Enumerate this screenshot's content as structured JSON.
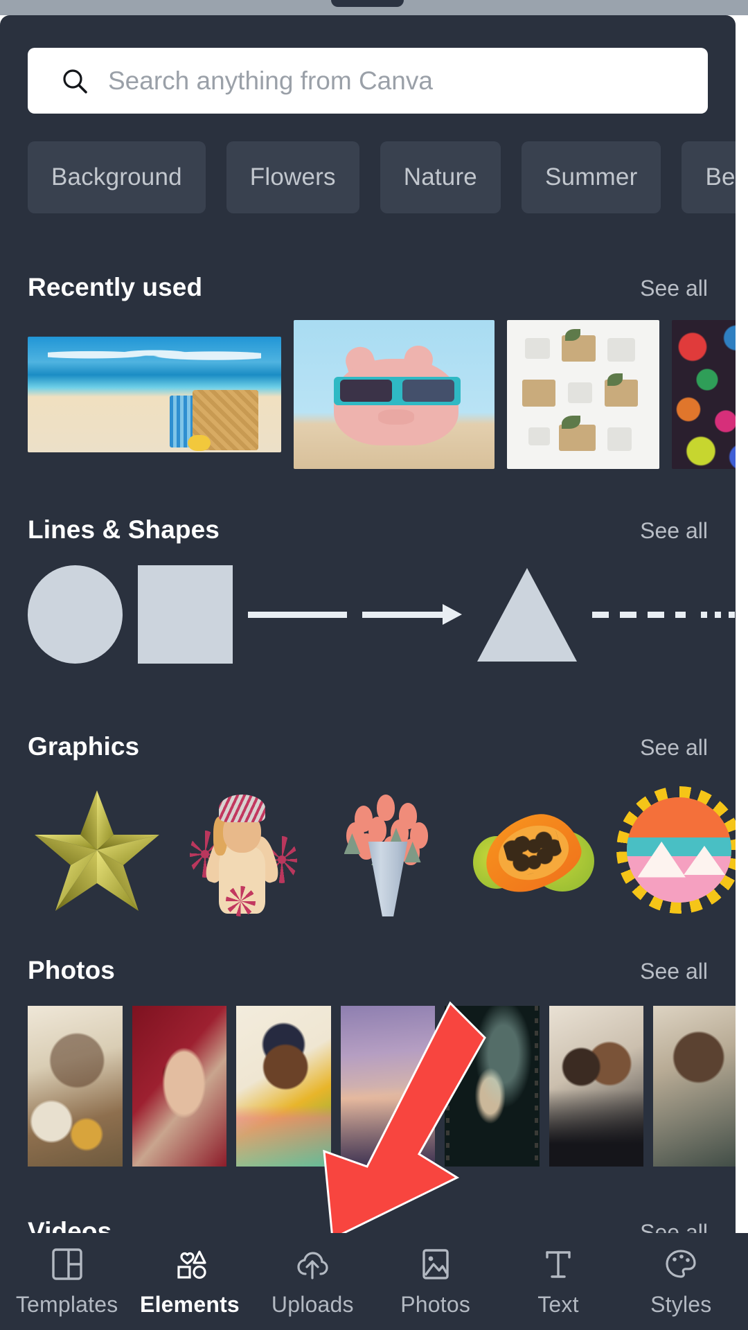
{
  "window": {
    "drag_handle": "sheet-drag-handle"
  },
  "search": {
    "placeholder": "Search anything from Canva",
    "value": "",
    "icon": "search-icon"
  },
  "chips": [
    {
      "label": "Background"
    },
    {
      "label": "Flowers"
    },
    {
      "label": "Nature"
    },
    {
      "label": "Summer"
    },
    {
      "label": "Beach"
    }
  ],
  "sections": [
    {
      "id": "recently-used",
      "title": "Recently used",
      "see_all": "See all",
      "items": [
        {
          "name": "beach-with-bag-photo"
        },
        {
          "name": "piggy-bank-sunglasses-photo"
        },
        {
          "name": "gift-boxes-flatlay-photo"
        },
        {
          "name": "colorful-abstract-photo"
        }
      ]
    },
    {
      "id": "lines-and-shapes",
      "title": "Lines & Shapes",
      "see_all": "See all",
      "items": [
        {
          "name": "circle-shape"
        },
        {
          "name": "square-shape"
        },
        {
          "name": "straight-line-shape"
        },
        {
          "name": "arrow-line-shape"
        },
        {
          "name": "triangle-shape"
        },
        {
          "name": "dashed-line-shape"
        },
        {
          "name": "dotted-line-shape"
        }
      ]
    },
    {
      "id": "graphics",
      "title": "Graphics",
      "see_all": "See all",
      "items": [
        {
          "name": "gold-star-graphic"
        },
        {
          "name": "woman-with-turban-graphic"
        },
        {
          "name": "tulip-bouquet-graphic"
        },
        {
          "name": "papaya-fruit-graphic"
        },
        {
          "name": "round-landscape-badge-graphic"
        }
      ]
    },
    {
      "id": "photos",
      "title": "Photos",
      "see_all": "See all",
      "items": [
        {
          "name": "woman-with-flowers-photo"
        },
        {
          "name": "hands-holding-flower-photo"
        },
        {
          "name": "smiling-woman-headwrap-photo"
        },
        {
          "name": "sunset-gradient-photo"
        },
        {
          "name": "hand-in-light-beam-photo"
        },
        {
          "name": "mother-and-newborn-photo"
        },
        {
          "name": "smiling-man-photo"
        }
      ]
    },
    {
      "id": "videos",
      "title": "Videos",
      "see_all": "See all",
      "items": []
    }
  ],
  "bottom_nav": {
    "active": "Elements",
    "items": [
      {
        "label": "Templates",
        "icon": "templates-icon",
        "active": false
      },
      {
        "label": "Elements",
        "icon": "elements-icon",
        "active": true
      },
      {
        "label": "Uploads",
        "icon": "uploads-icon",
        "active": false
      },
      {
        "label": "Photos",
        "icon": "photos-icon",
        "active": false
      },
      {
        "label": "Text",
        "icon": "text-icon",
        "active": false
      },
      {
        "label": "Styles",
        "icon": "styles-icon",
        "active": false
      }
    ]
  },
  "annotation": {
    "name": "red-pointer-arrow",
    "color": "#F8453F",
    "points_to": "Uploads"
  },
  "colors": {
    "sheet_background": "#2A313E",
    "chip_background": "#39414F",
    "accent_red": "#F8453F",
    "text_primary": "#FFFFFF",
    "text_secondary": "#B9BEC6",
    "shape_fill": "#CCD4DD",
    "status_bar": "#9AA3AD"
  }
}
